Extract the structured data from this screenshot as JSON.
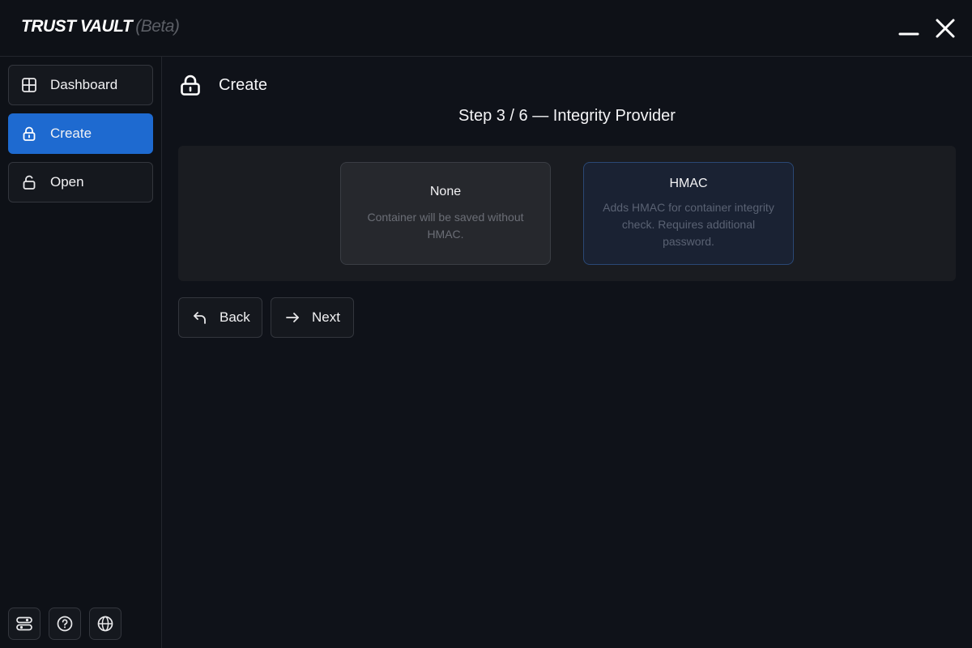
{
  "app": {
    "title": "TRUST VAULT",
    "badge": "(Beta)"
  },
  "window_controls": {
    "minimize_icon": "minimize-icon",
    "close_icon": "close-icon"
  },
  "sidebar": {
    "items": [
      {
        "label": "Dashboard",
        "icon": "grid-icon",
        "active": false
      },
      {
        "label": "Create",
        "icon": "lock-icon",
        "active": true
      },
      {
        "label": "Open",
        "icon": "unlock-icon",
        "active": false
      }
    ],
    "footer": [
      {
        "icon": "settings-toggles-icon"
      },
      {
        "icon": "help-circle-icon"
      },
      {
        "icon": "globe-icon"
      }
    ]
  },
  "main": {
    "header": {
      "icon": "lock-icon",
      "title": "Create"
    },
    "step_title": "Step 3 / 6 — Integrity Provider",
    "options": [
      {
        "title": "None",
        "description": "Container will be saved without HMAC.",
        "selected": false
      },
      {
        "title": "HMAC",
        "description": "Adds HMAC for container integrity check. Requires additional password.",
        "selected": true
      }
    ],
    "buttons": {
      "back": {
        "label": "Back",
        "icon": "undo-arrow-icon"
      },
      "next": {
        "label": "Next",
        "icon": "arrow-right-icon"
      }
    }
  },
  "colors": {
    "background": "#0f1219",
    "accent": "#1e6ad0",
    "selected_card_border": "#2a4875"
  }
}
